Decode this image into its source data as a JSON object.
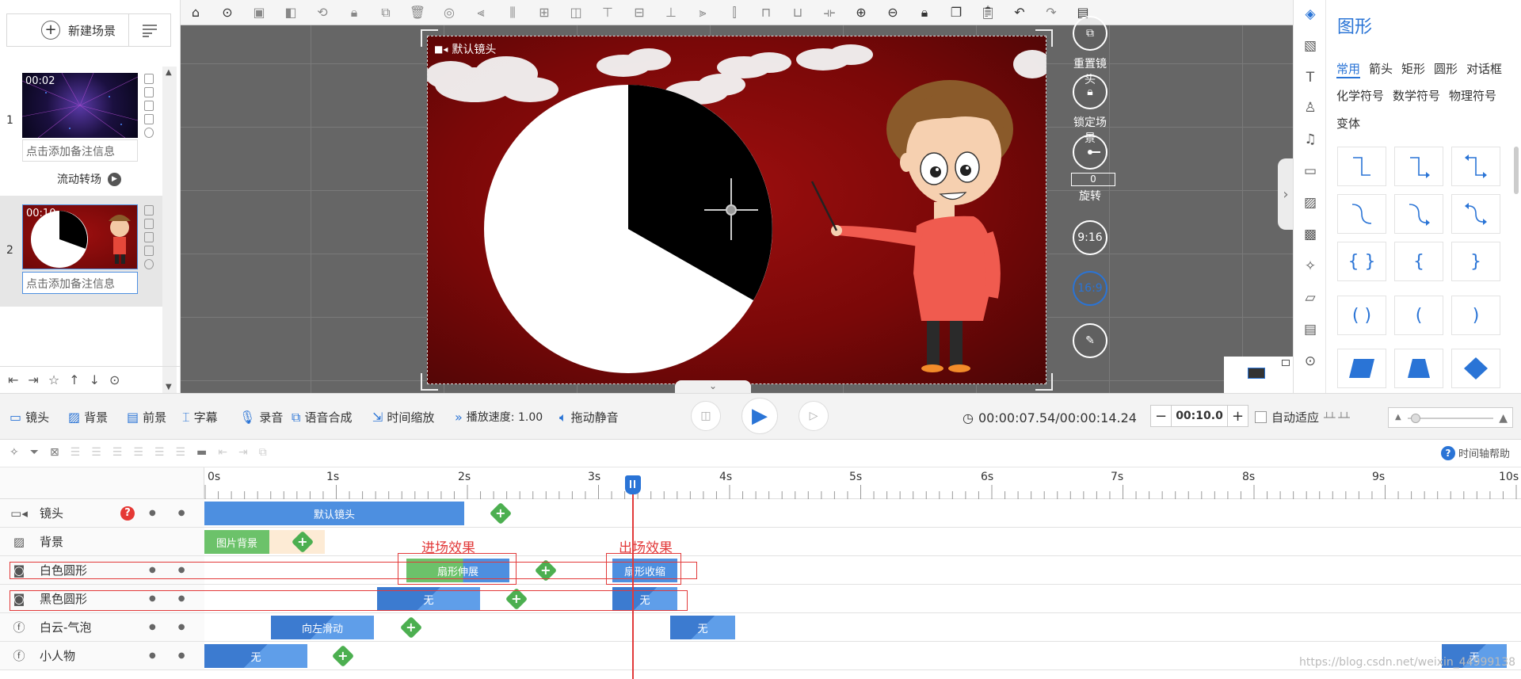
{
  "scene_panel": {
    "new_scene_label": "新建场景",
    "scenes": [
      {
        "index": "1",
        "time": "00:02",
        "note_placeholder": "点击添加备注信息"
      },
      {
        "index": "2",
        "time": "00:10",
        "note_placeholder": "点击添加备注信息"
      }
    ],
    "transition_label": "流动转场"
  },
  "stage": {
    "camera_label": "默认镜头",
    "reset_camera": "重置镜头",
    "lock_scene": "锁定场景",
    "rotate_value": "0",
    "rotate_label": "旋转",
    "ratio_916": "9:16",
    "ratio_169": "16:9"
  },
  "shape_panel": {
    "title": "图形",
    "tabs_row1": [
      "常用",
      "箭头",
      "矩形",
      "圆形",
      "对话框"
    ],
    "tabs_row2": [
      "化学符号",
      "数学符号",
      "物理符号"
    ],
    "tabs_row3": [
      "变体"
    ]
  },
  "bottom_toolbar": {
    "items": [
      "镜头",
      "背景",
      "前景",
      "字幕",
      "录音",
      "语音合成",
      "时间缩放",
      "播放速度: 1.00",
      "拖动静音"
    ],
    "time": "00:00:07.54/00:00:14.24",
    "zoom_value": "00:10.0",
    "auto_fit": "自动适应"
  },
  "timeline": {
    "help_label": "时间轴帮助",
    "ruler_labels": [
      "0s",
      "1s",
      "2s",
      "3s",
      "4s",
      "5s",
      "6s",
      "7s",
      "8s",
      "9s",
      "10s"
    ],
    "tracks": [
      {
        "name": "镜头",
        "clips": [
          "默认镜头"
        ]
      },
      {
        "name": "背景",
        "clips": [
          "图片背景"
        ]
      },
      {
        "name": "白色圆形",
        "clips": [
          "扇形伸展",
          "扇形收缩"
        ]
      },
      {
        "name": "黑色圆形",
        "clips": [
          "无",
          "无"
        ]
      },
      {
        "name": "白云-气泡",
        "clips": [
          "向左滑动",
          "无"
        ]
      },
      {
        "name": "小人物",
        "clips": [
          "无",
          "无"
        ]
      }
    ],
    "annotation_enter": "进场效果",
    "annotation_exit": "出场效果"
  },
  "watermark": "https://blog.csdn.net/weixin_44999138",
  "colors": {
    "accent": "#2a74d6",
    "stage_red": "#8e0b0b",
    "clip_blue": "#4d8fe0",
    "clip_green": "#6cc26a",
    "keyframe_green": "#4caf50",
    "annotation_red": "#e23a3a"
  }
}
